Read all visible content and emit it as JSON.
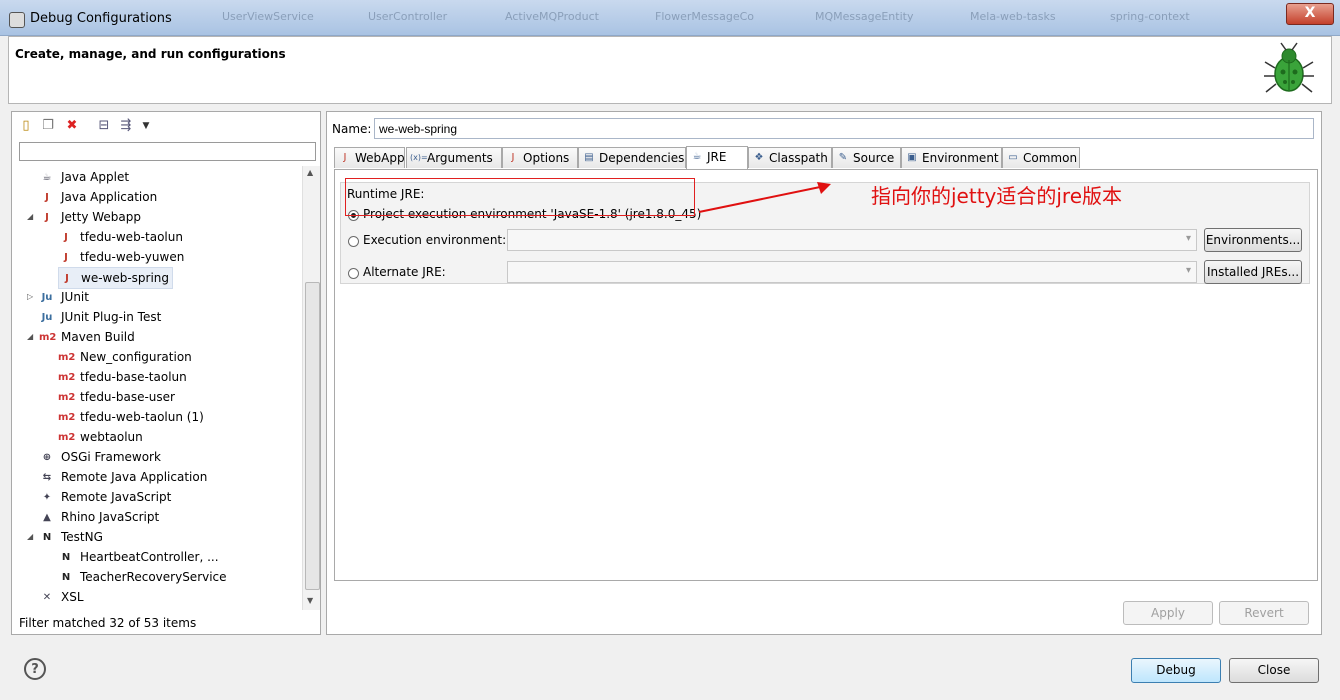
{
  "window": {
    "title": "Debug Configurations",
    "background_tabs": [
      "UserViewService",
      "UserController",
      "ActiveMQProduct",
      "FlowerMessageCo",
      "MQMessageEntity",
      "Mela-web-tasks",
      "spring-context"
    ],
    "close_label": "X"
  },
  "header": {
    "title": "Create, manage, and run configurations"
  },
  "left": {
    "filter_value": "",
    "tree": [
      {
        "label": "Java Applet",
        "icon": "java-applet-icon",
        "glyph": "☕",
        "indent": 0,
        "twisty": ""
      },
      {
        "label": "Java Application",
        "icon": "java-application-icon",
        "glyph": "J",
        "indent": 0,
        "twisty": ""
      },
      {
        "label": "Jetty Webapp",
        "icon": "jetty-icon",
        "glyph": "J",
        "indent": 0,
        "twisty": "◢"
      },
      {
        "label": "tfedu-web-taolun",
        "icon": "jetty-icon",
        "glyph": "J",
        "indent": 1,
        "twisty": ""
      },
      {
        "label": "tfedu-web-yuwen",
        "icon": "jetty-icon",
        "glyph": "J",
        "indent": 1,
        "twisty": ""
      },
      {
        "label": "we-web-spring",
        "icon": "jetty-icon",
        "glyph": "J",
        "indent": 1,
        "twisty": "",
        "selected": true
      },
      {
        "label": "JUnit",
        "icon": "junit-icon",
        "glyph": "Ju",
        "indent": 0,
        "twisty": "▷"
      },
      {
        "label": "JUnit Plug-in Test",
        "icon": "junit-plugin-icon",
        "glyph": "Ju",
        "indent": 0,
        "twisty": ""
      },
      {
        "label": "Maven Build",
        "icon": "maven-icon",
        "glyph": "m2",
        "indent": 0,
        "twisty": "◢"
      },
      {
        "label": "New_configuration",
        "icon": "maven-icon",
        "glyph": "m2",
        "indent": 1,
        "twisty": ""
      },
      {
        "label": "tfedu-base-taolun",
        "icon": "maven-icon",
        "glyph": "m2",
        "indent": 1,
        "twisty": ""
      },
      {
        "label": "tfedu-base-user",
        "icon": "maven-icon",
        "glyph": "m2",
        "indent": 1,
        "twisty": ""
      },
      {
        "label": "tfedu-web-taolun (1)",
        "icon": "maven-icon",
        "glyph": "m2",
        "indent": 1,
        "twisty": ""
      },
      {
        "label": "webtaolun",
        "icon": "maven-icon",
        "glyph": "m2",
        "indent": 1,
        "twisty": ""
      },
      {
        "label": "OSGi Framework",
        "icon": "osgi-icon",
        "glyph": "⊕",
        "indent": 0,
        "twisty": ""
      },
      {
        "label": "Remote Java Application",
        "icon": "remote-java-icon",
        "glyph": "⇆",
        "indent": 0,
        "twisty": ""
      },
      {
        "label": "Remote JavaScript",
        "icon": "remote-javascript-icon",
        "glyph": "✦",
        "indent": 0,
        "twisty": ""
      },
      {
        "label": "Rhino JavaScript",
        "icon": "rhino-icon",
        "glyph": "▲",
        "indent": 0,
        "twisty": ""
      },
      {
        "label": "TestNG",
        "icon": "testng-icon",
        "glyph": "N",
        "indent": 0,
        "twisty": "◢"
      },
      {
        "label": "HeartbeatController, ...",
        "icon": "testng-icon",
        "glyph": "N",
        "indent": 1,
        "twisty": ""
      },
      {
        "label": "TeacherRecoveryService",
        "icon": "testng-icon",
        "glyph": "N",
        "indent": 1,
        "twisty": ""
      },
      {
        "label": "XSL",
        "icon": "xsl-icon",
        "glyph": "✕",
        "indent": 0,
        "twisty": ""
      }
    ],
    "status": "Filter matched 32 of 53 items"
  },
  "right": {
    "name_label": "Name:",
    "name_value": "we-web-spring",
    "tabs": [
      {
        "label": "WebApp",
        "icon": "webapp-icon",
        "glyph": "J"
      },
      {
        "label": "Arguments",
        "icon": "arguments-icon",
        "glyph": "(x)="
      },
      {
        "label": "Options",
        "icon": "options-icon",
        "glyph": "J"
      },
      {
        "label": "Dependencies",
        "icon": "dependencies-icon",
        "glyph": "▤"
      },
      {
        "label": "JRE",
        "icon": "jre-icon",
        "glyph": "☕",
        "active": true
      },
      {
        "label": "Classpath",
        "icon": "classpath-icon",
        "glyph": "❖"
      },
      {
        "label": "Source",
        "icon": "source-icon",
        "glyph": "✎"
      },
      {
        "label": "Environment",
        "icon": "environment-icon",
        "glyph": "▣"
      },
      {
        "label": "Common",
        "icon": "common-icon",
        "glyph": "▭"
      }
    ],
    "runtime_jre_label": "Runtime JRE:",
    "option_project": "Project execution environment 'JavaSE-1.8' (jre1.8.0_45)",
    "option_execution": "Execution environment:",
    "option_alternate": "Alternate JRE:",
    "environments_button": "Environments...",
    "installed_jres_button": "Installed JREs...",
    "apply_button": "Apply",
    "revert_button": "Revert",
    "annotation": "指向你的jetty适合的jre版本"
  },
  "footer": {
    "debug_button": "Debug",
    "close_button": "Close",
    "help_glyph": "?"
  },
  "colors": {
    "annotation": "#e01010",
    "accent": "#3c7fb1"
  }
}
